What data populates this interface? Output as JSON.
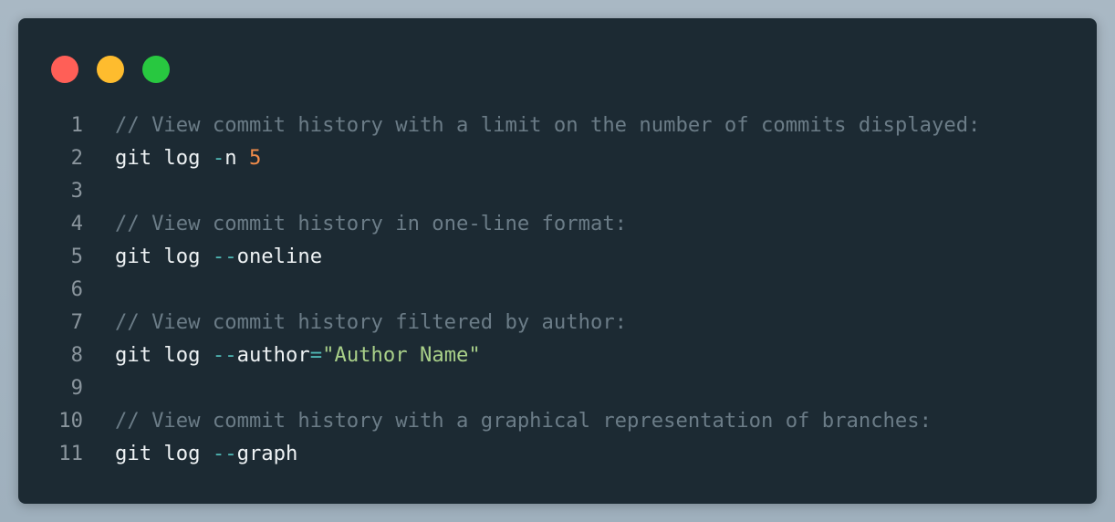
{
  "window": {
    "traffic_lights": [
      "close",
      "minimize",
      "maximize"
    ]
  },
  "code": {
    "lines": [
      {
        "n": "1",
        "tokens": [
          {
            "t": "comment",
            "v": "// View commit history with a limit on the number of commits displayed:"
          }
        ]
      },
      {
        "n": "2",
        "tokens": [
          {
            "t": "cmd",
            "v": "git log "
          },
          {
            "t": "flag",
            "v": "-"
          },
          {
            "t": "cmd",
            "v": "n "
          },
          {
            "t": "num",
            "v": "5"
          }
        ]
      },
      {
        "n": "3",
        "tokens": []
      },
      {
        "n": "4",
        "tokens": [
          {
            "t": "comment",
            "v": "// View commit history in one-line format:"
          }
        ]
      },
      {
        "n": "5",
        "tokens": [
          {
            "t": "cmd",
            "v": "git log "
          },
          {
            "t": "flag",
            "v": "--"
          },
          {
            "t": "cmd",
            "v": "oneline"
          }
        ]
      },
      {
        "n": "6",
        "tokens": []
      },
      {
        "n": "7",
        "tokens": [
          {
            "t": "comment",
            "v": "// View commit history filtered by author:"
          }
        ]
      },
      {
        "n": "8",
        "tokens": [
          {
            "t": "cmd",
            "v": "git log "
          },
          {
            "t": "flag",
            "v": "--"
          },
          {
            "t": "cmd",
            "v": "author"
          },
          {
            "t": "op",
            "v": "="
          },
          {
            "t": "str",
            "v": "\"Author Name\""
          }
        ]
      },
      {
        "n": "9",
        "tokens": []
      },
      {
        "n": "10",
        "tokens": [
          {
            "t": "comment",
            "v": "// View commit history with a graphical representation of branches:"
          }
        ]
      },
      {
        "n": "11",
        "tokens": [
          {
            "t": "cmd",
            "v": "git log "
          },
          {
            "t": "flag",
            "v": "--"
          },
          {
            "t": "cmd",
            "v": "graph"
          }
        ]
      }
    ]
  },
  "colors": {
    "background": "#1c2a33",
    "comment": "#6b7c87",
    "command": "#eef2f4",
    "flag": "#4fb7b4",
    "number": "#f28c4a",
    "string": "#a9d089",
    "line_number": "#8a959d"
  }
}
